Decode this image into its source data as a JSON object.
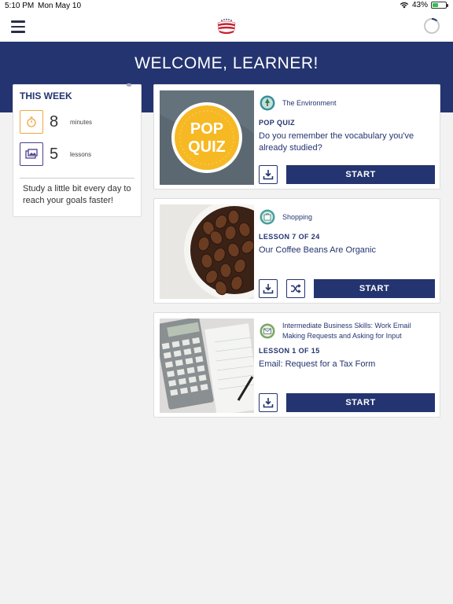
{
  "status_bar": {
    "time": "5:10 PM",
    "date": "Mon May 10",
    "battery": "43%",
    "battery_level": 0.43
  },
  "header": {
    "menu_icon": "menu-icon",
    "logo": "flag-logo",
    "profile_icon": "progress-ring-icon"
  },
  "hero": {
    "title": "WELCOME, LEARNER!"
  },
  "this_week": {
    "title": "THIS WEEK",
    "minutes": {
      "value": "8",
      "unit": "minutes",
      "icon": "stopwatch-icon",
      "color": "#f0a640"
    },
    "lessons": {
      "value": "5",
      "unit": "lessons",
      "icon": "lessons-icon",
      "color": "#4a3f8f"
    },
    "tip": "Study a little bit every day to reach your goals faster!"
  },
  "cards": [
    {
      "category": "The Environment",
      "category_icon": "environment-icon",
      "label": "POP QUIZ",
      "title": "Do you remember the vocabulary you've already studied?",
      "thumb": "pop-quiz-badge",
      "thumb_text_1": "POP",
      "thumb_text_2": "QUIZ",
      "start_label": "START",
      "has_shuffle": false
    },
    {
      "category": "Shopping",
      "category_icon": "shopping-icon",
      "label": "LESSON 7 OF 24",
      "title": "Our Coffee Beans Are Organic",
      "thumb": "coffee-beans-photo",
      "start_label": "START",
      "has_shuffle": true
    },
    {
      "category": "Intermediate Business Skills: Work Email Making Requests and Asking for Input",
      "category_icon": "business-email-icon",
      "label": "LESSON 1 OF 15",
      "title": "Email: Request for a Tax Form",
      "thumb": "calculator-photo",
      "start_label": "START",
      "has_shuffle": false
    }
  ],
  "colors": {
    "navy": "#243470",
    "background": "#f2f2f2",
    "quiz_yellow": "#f6b924"
  }
}
